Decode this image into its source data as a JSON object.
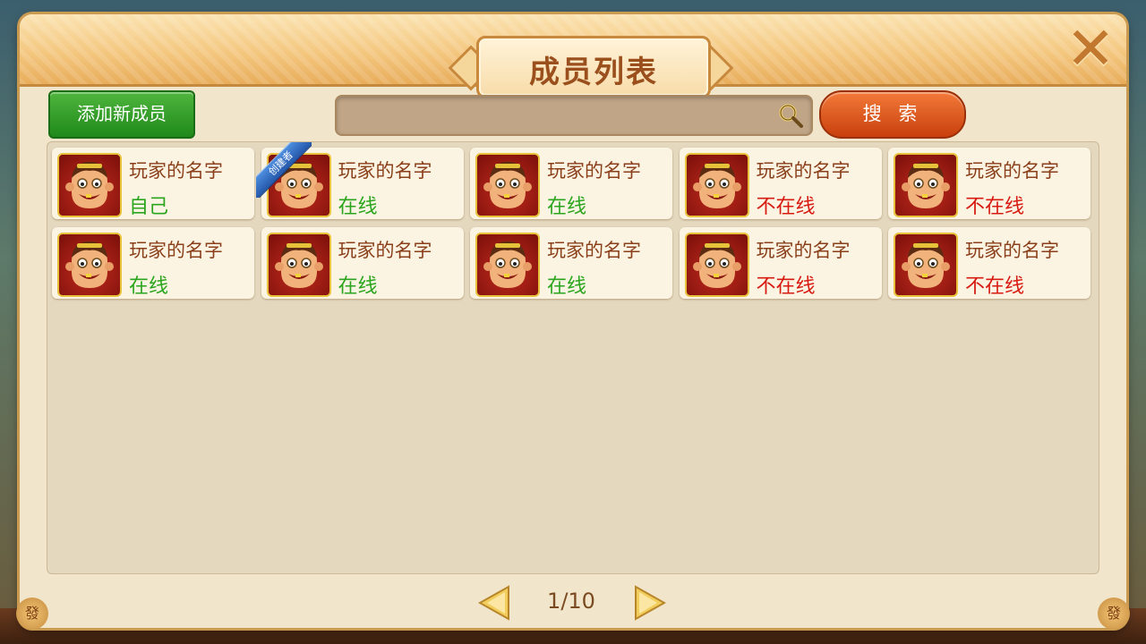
{
  "dialog": {
    "title": "成员列表",
    "close_label": "✕"
  },
  "toolbar": {
    "add_label": "添加新成员",
    "search_placeholder": "",
    "search_label": "搜 索"
  },
  "members": [
    {
      "name": "玩家的名字",
      "status": "自己",
      "status_color": "#2aa51d",
      "creator": false
    },
    {
      "name": "玩家的名字",
      "status": "在线",
      "status_color": "#2aa51d",
      "creator": true
    },
    {
      "name": "玩家的名字",
      "status": "在线",
      "status_color": "#2aa51d",
      "creator": false
    },
    {
      "name": "玩家的名字",
      "status": "不在线",
      "status_color": "#d81b12",
      "creator": false
    },
    {
      "name": "玩家的名字",
      "status": "不在线",
      "status_color": "#d81b12",
      "creator": false
    },
    {
      "name": "玩家的名字",
      "status": "在线",
      "status_color": "#2aa51d",
      "creator": false
    },
    {
      "name": "玩家的名字",
      "status": "在线",
      "status_color": "#2aa51d",
      "creator": false
    },
    {
      "name": "玩家的名字",
      "status": "在线",
      "status_color": "#2aa51d",
      "creator": false
    },
    {
      "name": "玩家的名字",
      "status": "不在线",
      "status_color": "#d81b12",
      "creator": false
    },
    {
      "name": "玩家的名字",
      "status": "不在线",
      "status_color": "#d81b12",
      "creator": false
    }
  ],
  "creator_badge": "创建者",
  "pagination": {
    "current": 1,
    "total": 10,
    "label": "1/10"
  },
  "corner_glyph": "發",
  "colors": {
    "online": "#2aa51d",
    "offline": "#d81b12",
    "add_button": "#2e9e25",
    "search_button": "#e0561f",
    "name_text": "#8a3f1a"
  }
}
